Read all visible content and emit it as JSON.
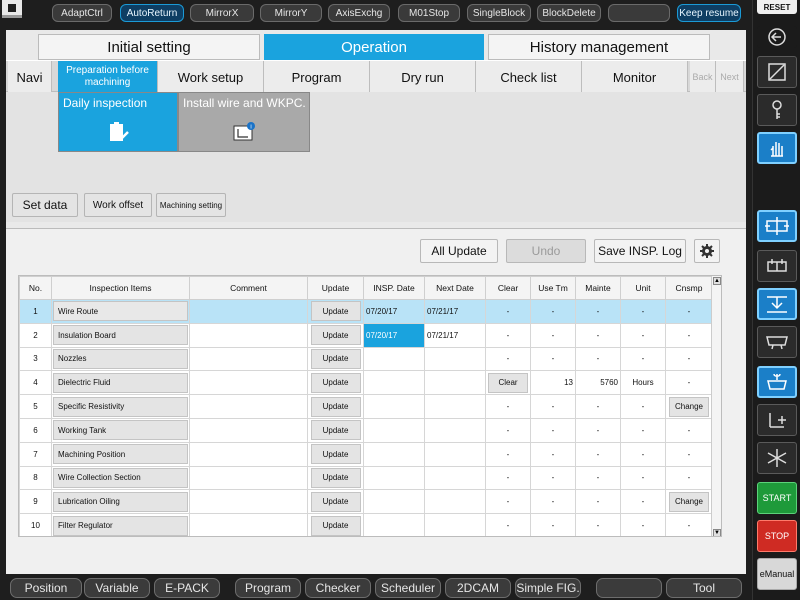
{
  "top_bar": {
    "buttons": [
      "AdaptCtrl",
      "AutoReturn",
      "MirrorX",
      "MirrorY",
      "AxisExchg",
      "M01Stop",
      "SingleBlock",
      "BlockDelete",
      "",
      "Keep resume"
    ]
  },
  "right_panel": {
    "reset_label": "RESET",
    "start_label": "START",
    "stop_label": "STOP",
    "manual_label": "eManual"
  },
  "main_tabs": [
    "Initial setting",
    "Operation",
    "History management"
  ],
  "sub_tabs": {
    "navi": "Navi",
    "prep": "Preparation before machining",
    "work_setup": "Work setup",
    "program": "Program",
    "dry_run": "Dry run",
    "check_list": "Check list",
    "monitor": "Monitor",
    "back": "Back",
    "next": "Next"
  },
  "tiles": {
    "daily": "Daily inspection",
    "install": "Install wire and WKPC."
  },
  "side_buttons": {
    "set_data": "Set data",
    "work_offset": "Work offset",
    "machining_setting": "Machining setting"
  },
  "content_buttons": {
    "all_update": "All Update",
    "undo": "Undo",
    "save_log": "Save INSP. Log"
  },
  "table": {
    "headers": [
      "No.",
      "Inspection Items",
      "Comment",
      "Update",
      "INSP. Date",
      "Next Date",
      "Clear",
      "Use Tm",
      "Mainte",
      "Unit",
      "Cnsmp"
    ],
    "rows": [
      {
        "no": "1",
        "item": "Wire Route",
        "comment": "",
        "update": "Update",
        "insp": "07/20/17",
        "next": "07/21/17",
        "clear": "-",
        "usetm": "-",
        "mainte": "-",
        "unit": "-",
        "cnsmp": "-"
      },
      {
        "no": "2",
        "item": "Insulation Board",
        "comment": "",
        "update": "Update",
        "insp": "07/20/17",
        "next": "07/21/17",
        "clear": "-",
        "usetm": "-",
        "mainte": "-",
        "unit": "-",
        "cnsmp": "-"
      },
      {
        "no": "3",
        "item": "Nozzles",
        "comment": "",
        "update": "Update",
        "insp": "",
        "next": "",
        "clear": "-",
        "usetm": "-",
        "mainte": "-",
        "unit": "-",
        "cnsmp": "-"
      },
      {
        "no": "4",
        "item": "Dielectric Fluid",
        "comment": "",
        "update": "Update",
        "insp": "",
        "next": "",
        "clear": "Clear",
        "usetm": "13",
        "mainte": "5760",
        "unit": "Hours",
        "cnsmp": "-"
      },
      {
        "no": "5",
        "item": "Specific Resistivity",
        "comment": "",
        "update": "Update",
        "insp": "",
        "next": "",
        "clear": "-",
        "usetm": "-",
        "mainte": "-",
        "unit": "-",
        "cnsmp": "Change"
      },
      {
        "no": "6",
        "item": "Working Tank",
        "comment": "",
        "update": "Update",
        "insp": "",
        "next": "",
        "clear": "-",
        "usetm": "-",
        "mainte": "-",
        "unit": "-",
        "cnsmp": "-"
      },
      {
        "no": "7",
        "item": "Machining Position",
        "comment": "",
        "update": "Update",
        "insp": "",
        "next": "",
        "clear": "-",
        "usetm": "-",
        "mainte": "-",
        "unit": "-",
        "cnsmp": "-"
      },
      {
        "no": "8",
        "item": "Wire Collection Section",
        "comment": "",
        "update": "Update",
        "insp": "",
        "next": "",
        "clear": "-",
        "usetm": "-",
        "mainte": "-",
        "unit": "-",
        "cnsmp": "-"
      },
      {
        "no": "9",
        "item": "Lubrication Oiling",
        "comment": "",
        "update": "Update",
        "insp": "",
        "next": "",
        "clear": "-",
        "usetm": "-",
        "mainte": "-",
        "unit": "-",
        "cnsmp": "Change"
      },
      {
        "no": "10",
        "item": "Filter Regulator",
        "comment": "",
        "update": "Update",
        "insp": "",
        "next": "",
        "clear": "-",
        "usetm": "-",
        "mainte": "-",
        "unit": "-",
        "cnsmp": "-"
      }
    ]
  },
  "bottom_bar": {
    "buttons": [
      "Position",
      "Variable",
      "E-PACK",
      "Program",
      "Checker",
      "Scheduler",
      "2DCAM",
      "Simple FIG.",
      "",
      "Tool"
    ]
  }
}
